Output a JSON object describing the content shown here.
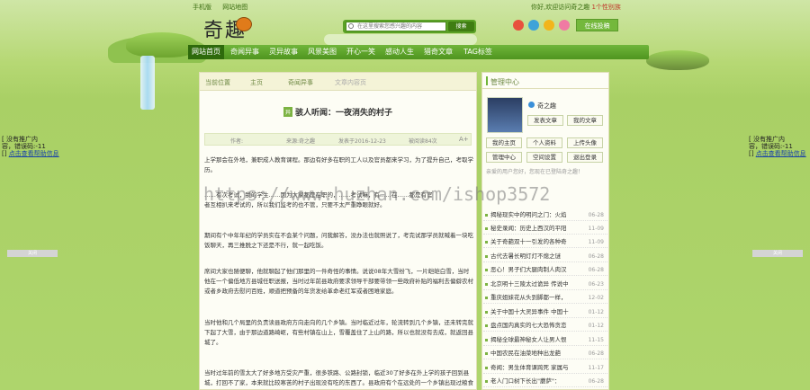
{
  "top": {
    "links": [
      "手机版",
      "网站地图"
    ],
    "greeting_prefix": "你好,欢迎访问奇之趣",
    "greeting_count": "1个性别族"
  },
  "logo": {
    "text": "奇趣"
  },
  "search": {
    "placeholder": "在这里搜索您感兴趣的内容",
    "button": "搜索"
  },
  "submit_button": "在线投稿",
  "nav": [
    "网站首页",
    "奇闻异事",
    "灵异故事",
    "风景美图",
    "开心一笑",
    "感动人生",
    "猎奇文章",
    "TAG标签"
  ],
  "side_ads": {
    "left": {
      "line1": "没有推广内",
      "line2": "容，错误码:-11",
      "link": "点击查看帮助信息",
      "close": "关闭"
    },
    "right": {
      "line1": "没有推广内",
      "line2": "容，错误码:-11",
      "link": "点击查看帮助信息",
      "close": "关闭"
    }
  },
  "breadcrumb": {
    "label": "当前位置",
    "home": "主页",
    "category": "奇闻异事",
    "current": "文章内容页"
  },
  "article": {
    "tag": "异",
    "title": "骇人听闻：一夜消失的村子",
    "author_label": "作者:",
    "source": "来源:奇之趣",
    "date": "发表于2016-12-23",
    "views": "被阅读84次",
    "font_toggle": "A+",
    "paragraphs": [
      "上学那会在外地，兼职成人教育课程。那边有好多在职的工人以及官员都来学习，为了提升自己，考取学历。",
      "……有次考试，我的学生……因为大家都是在职的，……考试嘛，有……在……都是有官",
      "者互相扒来考试的，所以我们监考的也不管，只要不太严重睁眼就好。",
      "期间有个中年年纪的学员实在不会某个问题，问我解答，没办法也就照说了，考完试那学员就喊着一块吃饭聊天，再三推脱之下还是不行，就一起吃饭。",
      "席间大家也随便聊，他就聊起了他们那里的一件奇怪的事情。说说08年大雪纷飞，一片皑皑白雪，当时他在一个偏低地方县城任职送报，当时过年前县政府要求领导干部要带领一些政府补贴的福利去偏僻农村或者乡政府去慰问百姓，顺道把预备的年货发给革命老红军或者困难家庭。",
      "当时他和几个局里的负责读县政府方向走向的几个乡镇。当时临近过年，轮流转到几个乡镇，还未转完就下起了大雪，由于那边道路崎岖，有些村镇在山上，雪覆盖住了上山的路，所以也就没有去成，就返回县城了。",
      "当时过年前的雪太大了好多地方受灾严重，很多铁路、公路封锁，临近30了好多在外上学的孩子回到县城，打回不了家，本来就比较寒苦的村子出现没有吃的东西了。县政府有个在远处的一个乡镇出现过粮食"
    ]
  },
  "sidebar": {
    "title": "管理中心",
    "username": "奇之趣",
    "buttons": [
      "发表文章",
      "我的文章",
      "我的主页",
      "个人资料",
      "上传头像",
      "管理中心",
      "空间设置",
      "退出登录"
    ],
    "hint": "亲爱的用户您好，您现在已登陆奇之趣！",
    "list": [
      {
        "title": "揭秘现实中的明问之门：火焰",
        "date": "06-28"
      },
      {
        "title": "秘史录闻：历史上西汉的平阳",
        "date": "11-09"
      },
      {
        "title": "关于奇葩双十一引发的各种奇",
        "date": "11-09"
      },
      {
        "title": "古代去暑长明灯灯不熄之谜",
        "date": "06-28"
      },
      {
        "title": "恶心！男子们大腿肉制人肉汉",
        "date": "06-28"
      },
      {
        "title": "北京明十三陵太过诡异 传说中",
        "date": "06-23"
      },
      {
        "title": "重庆姐妹花从头到脚都一样，",
        "date": "12-02"
      },
      {
        "title": "关于中国十大灵异事件 中国十",
        "date": "01-12"
      },
      {
        "title": "盘点国内真实的七大恐怖贪恋",
        "date": "01-12"
      },
      {
        "title": "揭秘全球最神秘女人让男人恨",
        "date": "11-15"
      },
      {
        "title": "中国农民在油菜地种出龙葩",
        "date": "06-28"
      },
      {
        "title": "奇闻：男生体育课跨死 家属与",
        "date": "11-17"
      },
      {
        "title": "老人门口树下长出\"蘑萨\"：",
        "date": "06-28"
      }
    ]
  },
  "watermark": "https://www.huzhan.com/ishop3572",
  "colors": {
    "nav_green": "#4f951f",
    "nav_active": "#2e6a0c",
    "panel_bg": "#fdfdf5",
    "accent": "#7cb342"
  }
}
